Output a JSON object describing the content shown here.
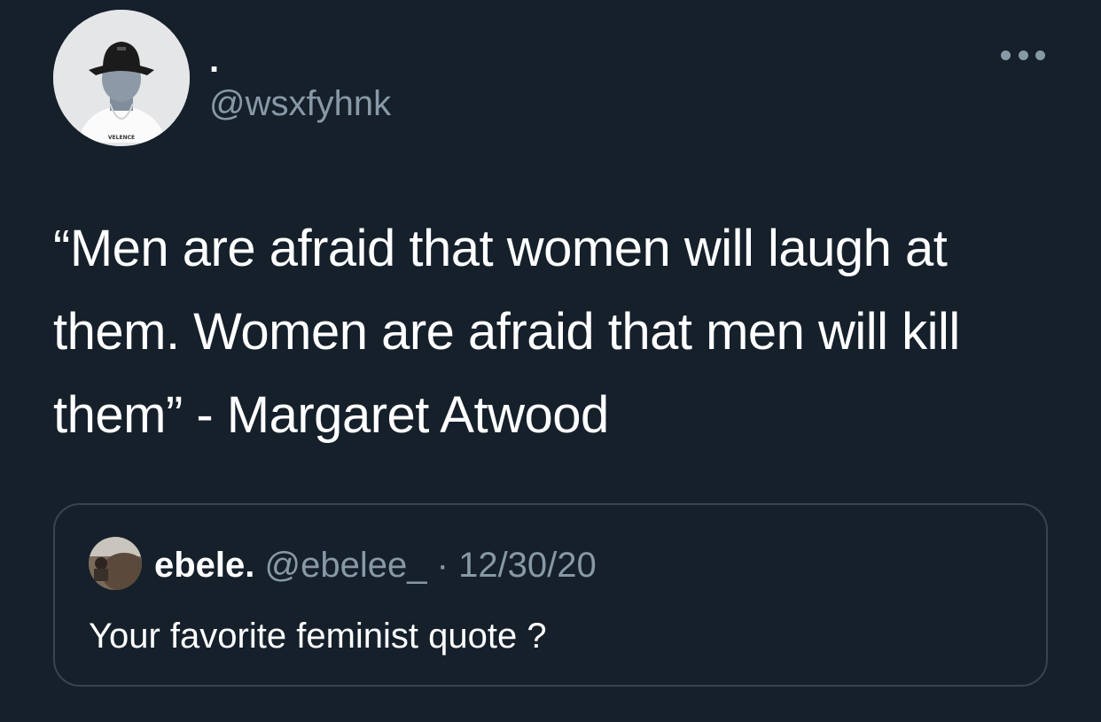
{
  "tweet": {
    "display_name": ".",
    "handle": "@wsxfyhnk",
    "avatar_icon": "user-avatar-bucket-hat",
    "more_icon": "more-horizontal-icon",
    "text": "“Men are afraid that women will laugh at them. Women are afraid that men will kill them” - Margaret Atwood"
  },
  "quoted": {
    "display_name": "ebele.",
    "handle": "@ebelee_",
    "separator": "·",
    "date": "12/30/20",
    "text": "Your favorite feminist quote ?"
  },
  "colors": {
    "background": "#15202b",
    "primary_text": "#ffffff",
    "secondary_text": "#8899a6",
    "card_border": "#38444d"
  }
}
